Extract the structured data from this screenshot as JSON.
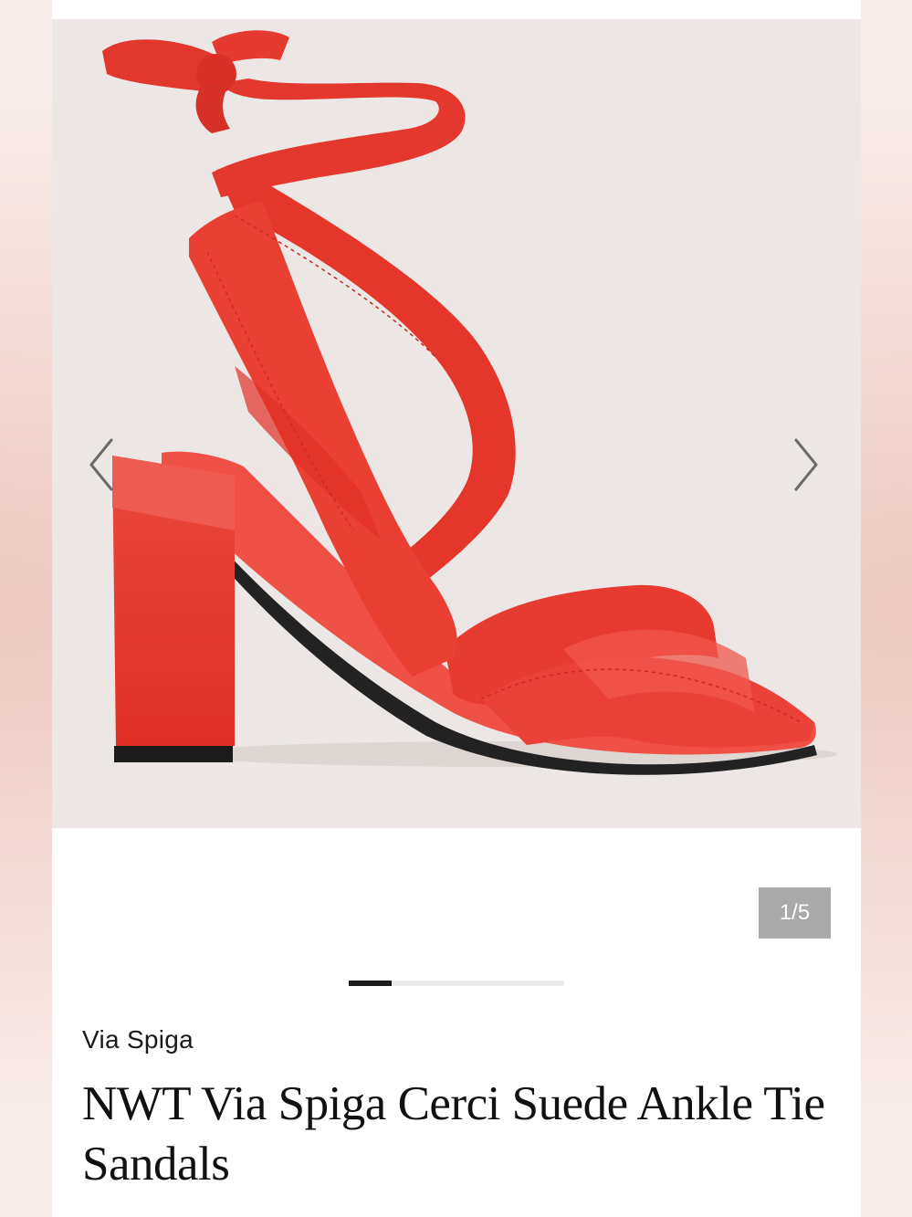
{
  "gallery": {
    "image_alt": "Red suede ankle tie block heel sandal",
    "counter": "1/5",
    "prev_icon": "chevron-left-icon",
    "next_icon": "chevron-right-icon",
    "progress": 0.2
  },
  "listing": {
    "brand": "Via Spiga",
    "title": "NWT Via Spiga Cerci Suede Ankle Tie Sandals"
  },
  "colors": {
    "shoe_red": "#e8362c",
    "background": "#ece7e4",
    "counter_bg": "#a9a9a9"
  }
}
